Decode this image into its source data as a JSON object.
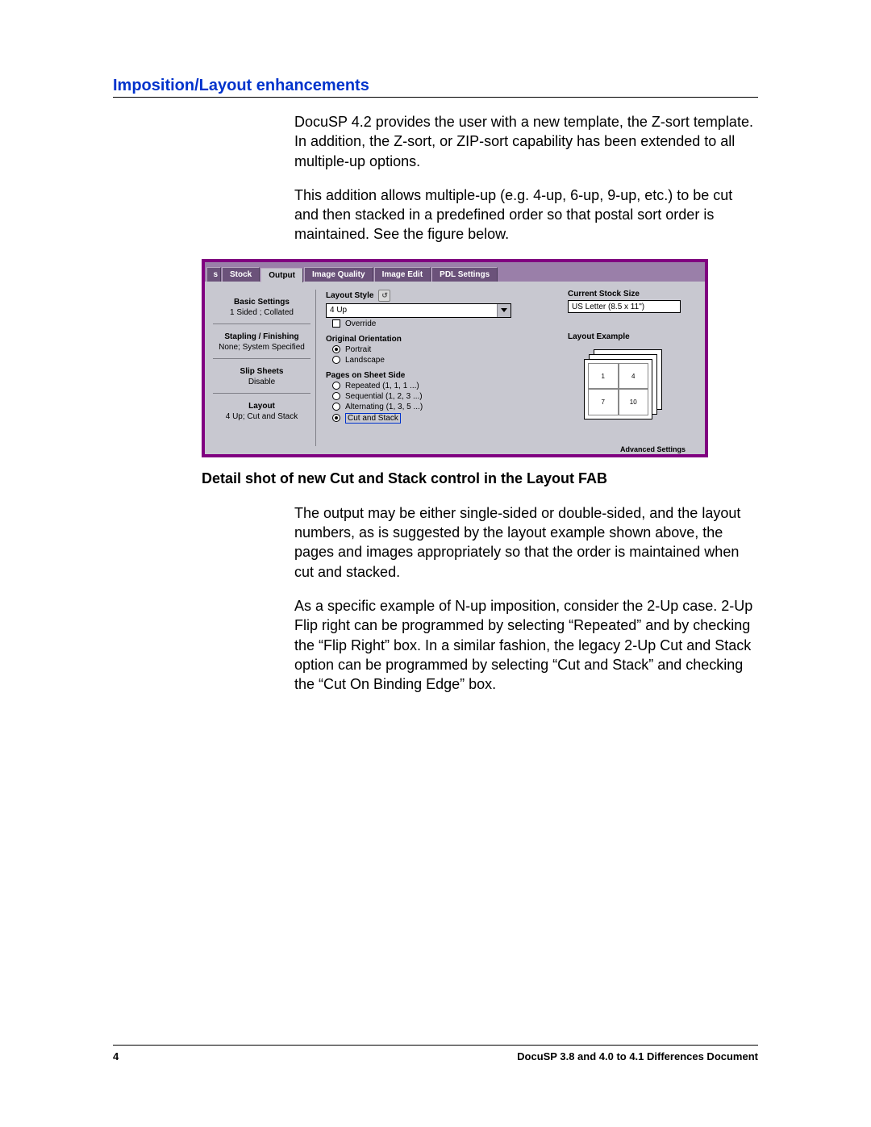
{
  "heading": "Imposition/Layout enhancements",
  "para1": "DocuSP 4.2 provides the user with a new template, the Z-sort template.  In addition, the Z-sort, or ZIP-sort capability has been extended to all multiple-up options.",
  "para2": "This addition allows multiple-up (e.g. 4-up, 6-up, 9-up, etc.) to be cut and then stacked in a predefined order so that postal sort order is maintained. See the figure below.",
  "caption": "Detail shot of new Cut and Stack control in the Layout FAB",
  "para3": "The output may be either single-sided or double-sided, and the layout numbers, as is suggested by the layout example shown above, the pages and images appropriately so that the order is maintained when cut and stacked.",
  "para4": "As a specific example of N-up imposition, consider the 2-Up case.  2-Up Flip right can be programmed by selecting “Repeated” and by checking the “Flip Right” box. In a similar fashion, the legacy 2-Up Cut and Stack option can be programmed by selecting “Cut and Stack” and checking the “Cut On Binding Edge” box.",
  "footer": {
    "page": "4",
    "doc": "DocuSP 3.8 and 4.0 to 4.1 Differences Document"
  },
  "shot": {
    "tabs": {
      "edge": "s",
      "stock": "Stock",
      "output": "Output",
      "iq": "Image Quality",
      "ie": "Image Edit",
      "pdl": "PDL Settings"
    },
    "sidebar": {
      "basic_h": "Basic Settings",
      "basic_v": "1 Sided ; Collated",
      "staple_h": "Stapling / Finishing",
      "staple_v": "None; System Specified",
      "slip_h": "Slip Sheets",
      "slip_v": "Disable",
      "layout_h": "Layout",
      "layout_v": "4 Up; Cut and Stack"
    },
    "center": {
      "layout_style_label": "Layout Style",
      "layout_style_value": "4 Up",
      "override": "Override",
      "orig_orient": "Original Orientation",
      "portrait": "Portrait",
      "landscape": "Landscape",
      "pages_on": "Pages on Sheet Side",
      "repeated": "Repeated (1, 1, 1 ...)",
      "sequential": "Sequential (1, 2, 3 ...)",
      "alternating": "Alternating (1, 3, 5 ...)",
      "cut_stack": "Cut and Stack"
    },
    "right": {
      "css_label": "Current Stock Size",
      "css_value": "US Letter (8.5 x 11\")",
      "lex_label": "Layout Example",
      "cells": [
        "1",
        "4",
        "7",
        "10"
      ],
      "adv": "Advanced Settings"
    }
  }
}
